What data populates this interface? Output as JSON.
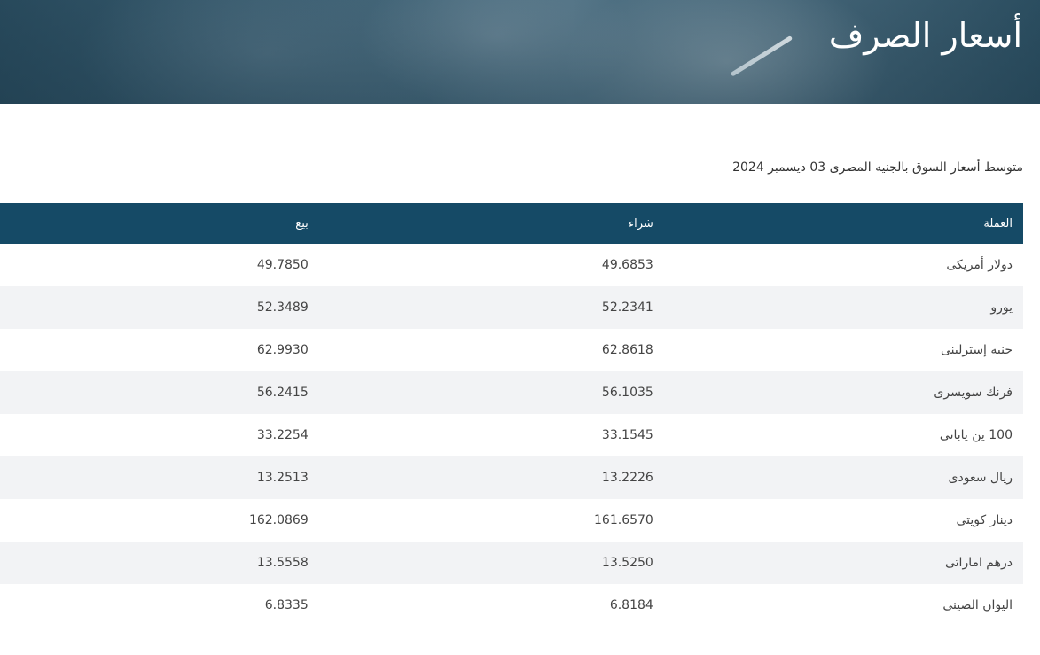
{
  "header": {
    "title": "أسعار الصرف"
  },
  "subtitle": "متوسط أسعار السوق بالجنيه المصرى 03 ديسمبر 2024",
  "table": {
    "columns": [
      "العملة",
      "شراء",
      "بيع"
    ],
    "rows": [
      {
        "currency": "دولار أمريكى",
        "buy": "49.6853",
        "sell": "49.7850"
      },
      {
        "currency": "يورو",
        "buy": "52.2341",
        "sell": "52.3489"
      },
      {
        "currency": "جنيه إسترلينى",
        "buy": "62.8618",
        "sell": "62.9930"
      },
      {
        "currency": "فرنك سويسرى",
        "buy": "56.1035",
        "sell": "56.2415"
      },
      {
        "currency": "100 ين يابانى",
        "buy": "33.1545",
        "sell": "33.2254"
      },
      {
        "currency": "ريال سعودى",
        "buy": "13.2226",
        "sell": "13.2513"
      },
      {
        "currency": "دينار كويتى",
        "buy": "161.6570",
        "sell": "162.0869"
      },
      {
        "currency": "درهم اماراتى",
        "buy": "13.5250",
        "sell": "13.5558"
      },
      {
        "currency": "اليوان الصينى",
        "buy": "6.8184",
        "sell": "6.8335"
      }
    ]
  },
  "colors": {
    "header_bg": "#154a66",
    "row_alt_bg": "#f2f3f5"
  }
}
